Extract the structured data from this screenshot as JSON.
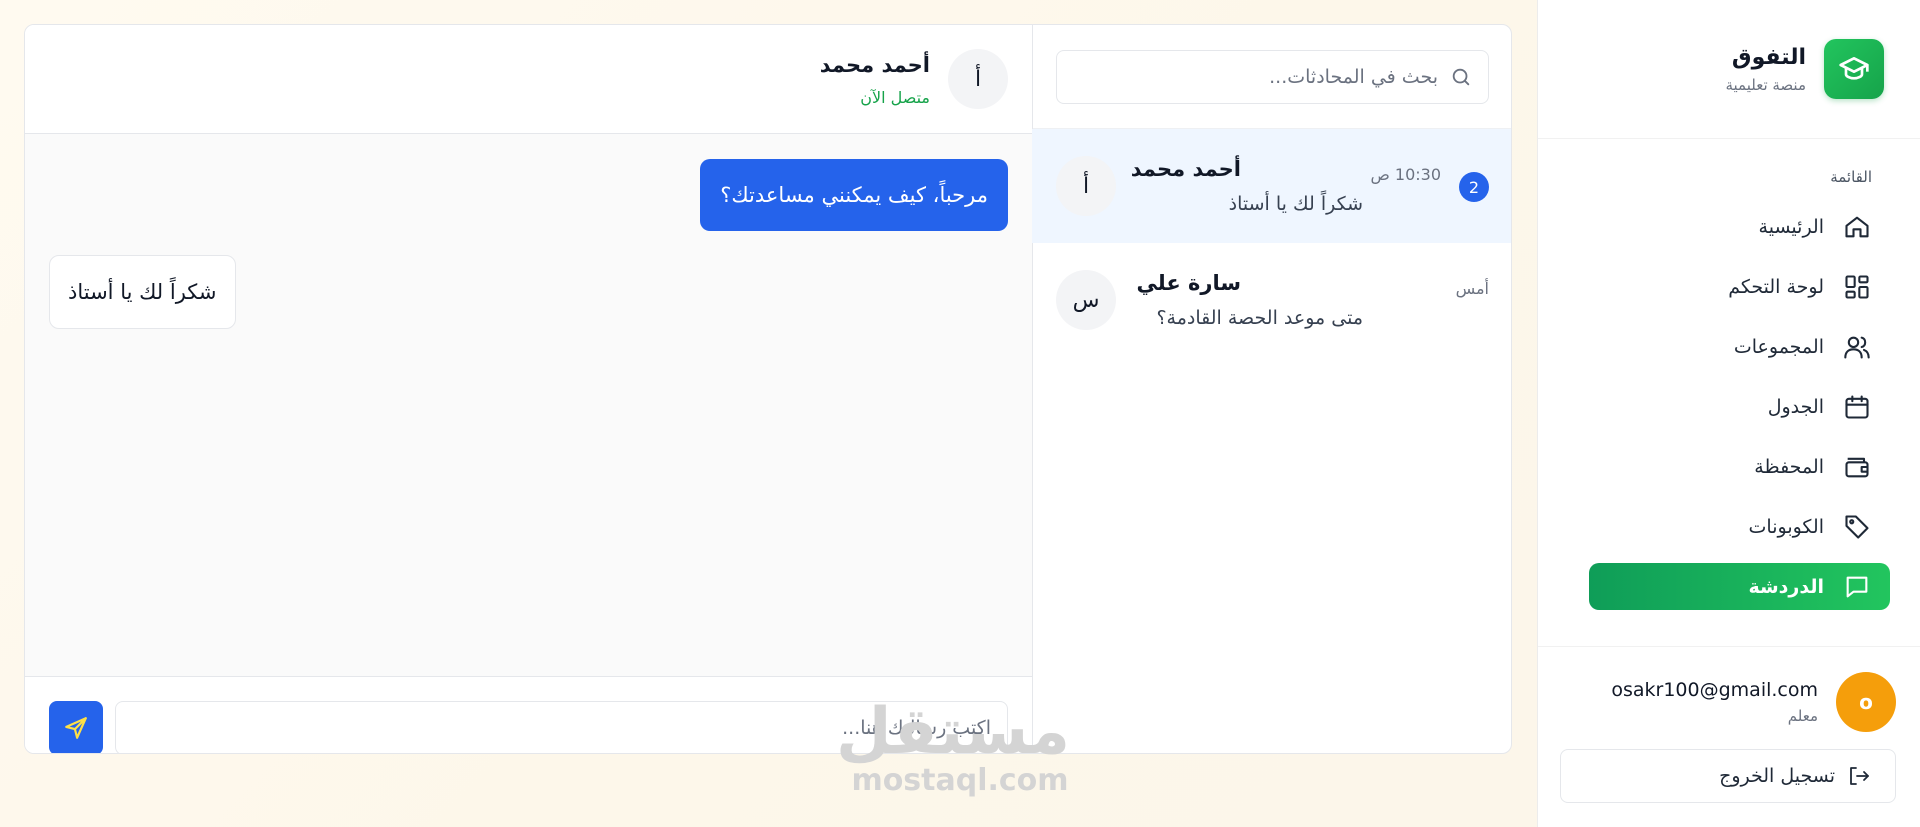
{
  "brand": {
    "title": "التفوق",
    "subtitle": "منصة تعليمية",
    "accent": "#16a34a"
  },
  "sidebar": {
    "menu_label": "القائمة",
    "items": [
      {
        "label": "الرئيسية",
        "icon": "home-icon"
      },
      {
        "label": "لوحة التحكم",
        "icon": "dashboard-icon"
      },
      {
        "label": "المجموعات",
        "icon": "users-icon"
      },
      {
        "label": "الجدول",
        "icon": "calendar-icon"
      },
      {
        "label": "المحفظة",
        "icon": "wallet-icon"
      },
      {
        "label": "الكوبونات",
        "icon": "tag-icon"
      },
      {
        "label": "الدردشة",
        "icon": "chat-icon",
        "active": true
      }
    ]
  },
  "user": {
    "initial": "o",
    "email": "osakr100@gmail.com",
    "role": "معلم",
    "avatar_color": "#f59e0b"
  },
  "logout": {
    "label": "تسجيل الخروج"
  },
  "search": {
    "placeholder": "بحث في المحادثات..."
  },
  "conversations": [
    {
      "initial": "أ",
      "name": "أحمد محمد",
      "time": "10:30 ص",
      "last_message": "شكراً لك يا أستاذ",
      "unread": "2",
      "active": true
    },
    {
      "initial": "س",
      "name": "سارة علي",
      "time": "أمس",
      "last_message": "متى موعد الحصة القادمة؟",
      "active": false
    }
  ],
  "chat": {
    "contact_initial": "أ",
    "contact_name": "أحمد محمد",
    "contact_status": "متصل الآن",
    "messages": [
      {
        "direction": "out",
        "text": "مرحباً، كيف يمكنني مساعدتك؟"
      },
      {
        "direction": "in",
        "text": "شكراً لك يا أستاذ"
      }
    ],
    "input_placeholder": "اكتب رسالتك هنا...",
    "send_color": "#2563eb"
  },
  "watermark": {
    "arabic": "مستقل",
    "latin": "mostaql.com"
  }
}
